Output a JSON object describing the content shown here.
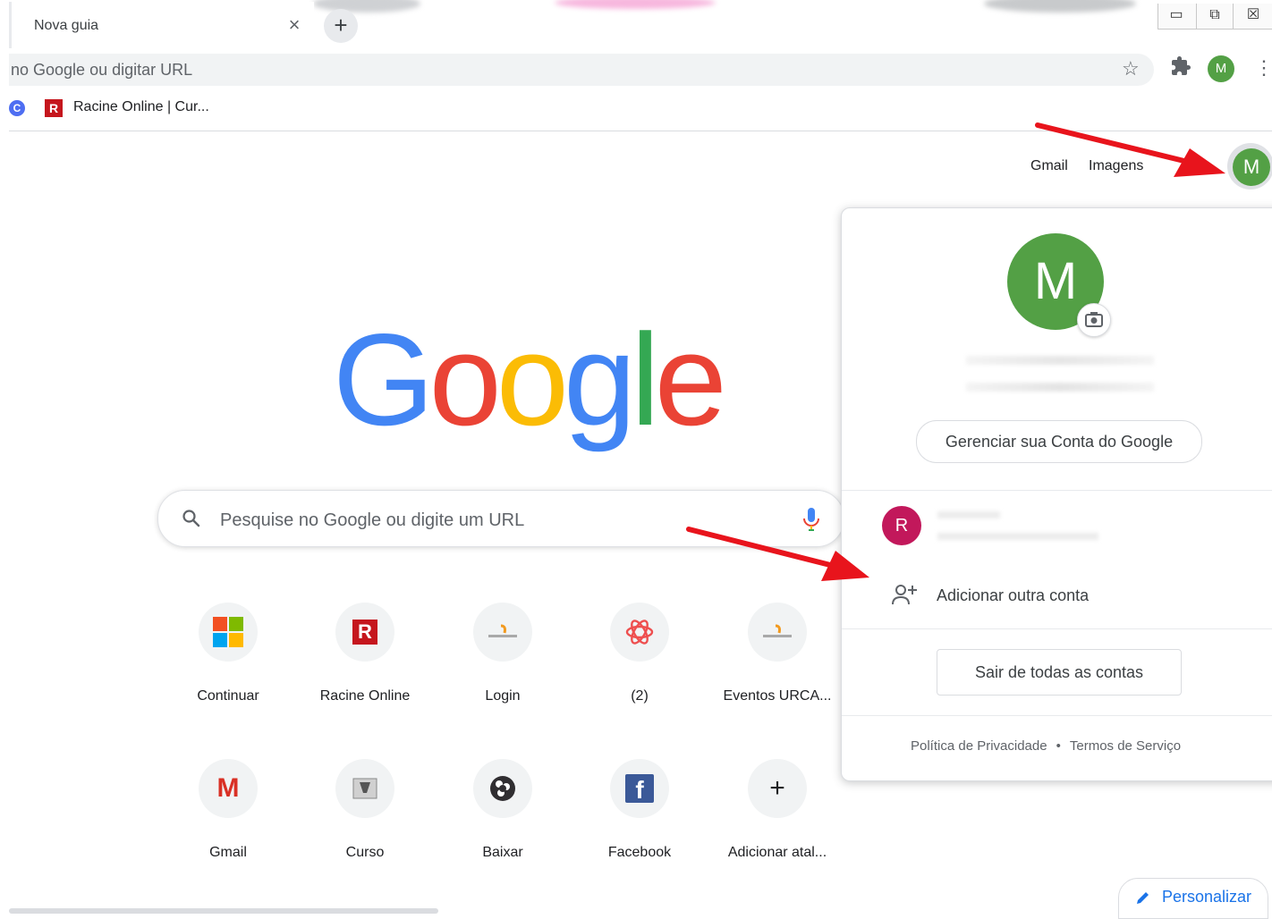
{
  "browser": {
    "tab_title": "Nova guia",
    "tab_close_glyph": "×",
    "new_tab_glyph": "+",
    "window_controls": [
      "▭",
      "⧉",
      "☒"
    ],
    "omnibox_text": "no Google ou digitar URL",
    "toolbar_avatar_initial": "M",
    "bookmark_c_initial": "C",
    "bookmark_r_initial": "R",
    "bookmark_label": "Racine Online | Cur..."
  },
  "header": {
    "gmail": "Gmail",
    "images": "Imagens",
    "avatar_initial": "M"
  },
  "search": {
    "placeholder": "Pesquise no Google ou digite um URL"
  },
  "shortcuts": [
    {
      "label": "Continuar",
      "icon": "microsoft-icon"
    },
    {
      "label": "Racine Online",
      "icon": "racine-icon"
    },
    {
      "label": "Login",
      "icon": "urcamp-icon"
    },
    {
      "label": "(2)",
      "icon": "openai-icon"
    },
    {
      "label": "Eventos URCA...",
      "icon": "urcamp-icon"
    },
    {
      "label": "Gmail",
      "icon": "gmail-icon"
    },
    {
      "label": "Curso",
      "icon": "curso-icon"
    },
    {
      "label": "Baixar",
      "icon": "obs-icon"
    },
    {
      "label": "Facebook",
      "icon": "facebook-icon"
    },
    {
      "label": "Adicionar atal...",
      "icon": "plus-icon"
    }
  ],
  "shortcut_glyphs": {
    "racine": "R",
    "gmail": "M",
    "facebook": "f",
    "add": "+"
  },
  "account_popup": {
    "avatar_initial": "M",
    "manage_label": "Gerenciar sua Conta do Google",
    "other_account_initial": "R",
    "add_account_label": "Adicionar outra conta",
    "signout_label": "Sair de todas as contas",
    "privacy_label": "Política de Privacidade",
    "separator": "•",
    "terms_label": "Termos de Serviço"
  },
  "customize_label": "Personalizar",
  "colors": {
    "google_blue": "#4285F4",
    "google_red": "#EA4335",
    "google_yellow": "#FBBC05",
    "google_green": "#34A853",
    "avatar_green": "#53a045",
    "account2_pink": "#c2185b",
    "annotation_arrow": "#e8141c"
  }
}
